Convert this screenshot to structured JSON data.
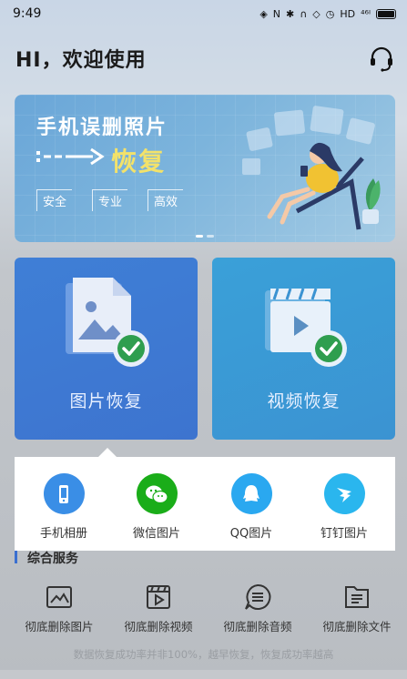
{
  "status_bar": {
    "time": "9:49",
    "network_label": "HD",
    "signal_label": "⁴⁶ᴵ"
  },
  "header": {
    "greeting": "HI，欢迎使用"
  },
  "banner": {
    "title": "手机误删照片",
    "subtitle": "恢复",
    "tags": [
      "安全",
      "专业",
      "高效"
    ]
  },
  "cards": {
    "photo": {
      "label": "图片恢复"
    },
    "video": {
      "label": "视频恢复"
    }
  },
  "popup": {
    "items": [
      {
        "label": "手机相册",
        "color": "#3a8ee6",
        "icon": "phone-icon"
      },
      {
        "label": "微信图片",
        "color": "#1aad19",
        "icon": "wechat-icon"
      },
      {
        "label": "QQ图片",
        "color": "#2aa8f0",
        "icon": "qq-icon"
      },
      {
        "label": "钉钉图片",
        "color": "#2ab6ee",
        "icon": "dingtalk-icon"
      }
    ]
  },
  "services": {
    "title": "综合服务",
    "items": [
      {
        "label": "彻底删除图片",
        "icon": "image-icon"
      },
      {
        "label": "彻底删除视频",
        "icon": "video-icon"
      },
      {
        "label": "彻底删除音频",
        "icon": "audio-icon"
      },
      {
        "label": "彻底删除文件",
        "icon": "file-icon"
      }
    ],
    "footnote": "数据恢复成功率并非100%，越早恢复，恢复成功率越高"
  }
}
